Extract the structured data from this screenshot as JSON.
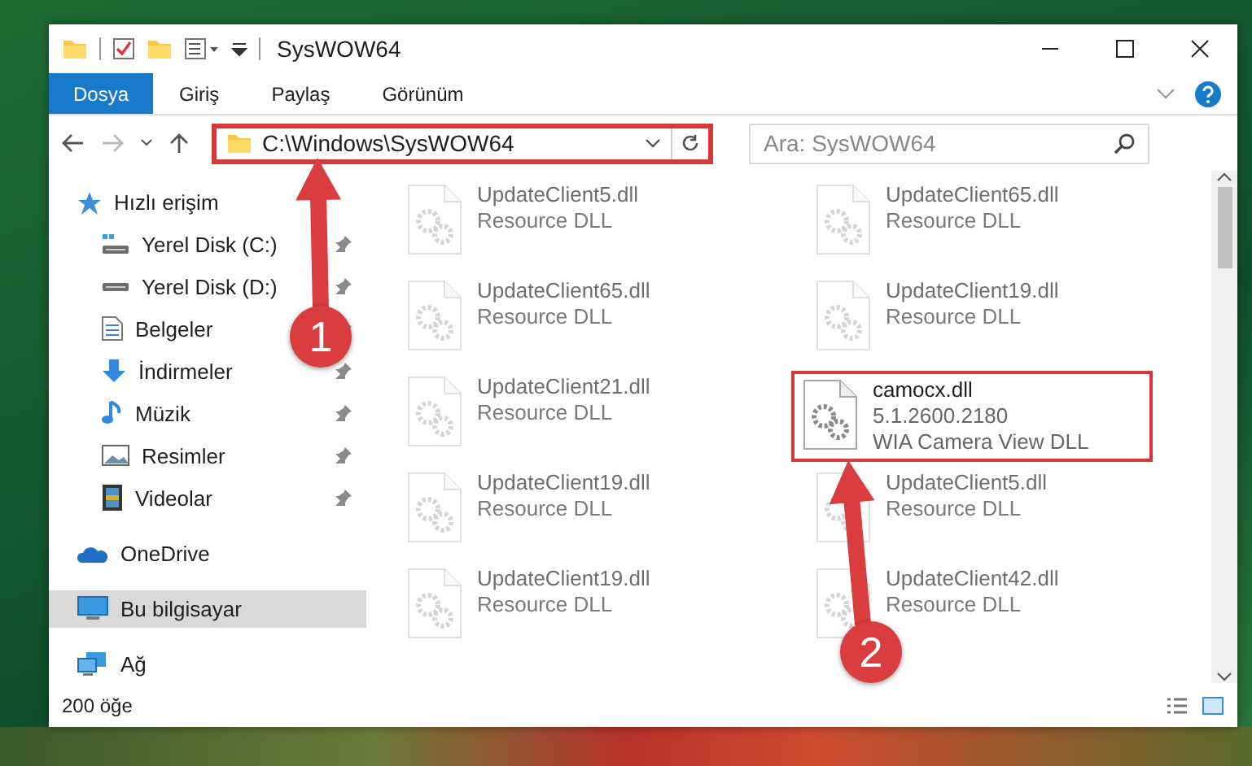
{
  "window": {
    "title": "SysWOW64"
  },
  "ribbon": {
    "tabs": [
      {
        "label": "Dosya",
        "selected": true
      },
      {
        "label": "Giriş",
        "selected": false
      },
      {
        "label": "Paylaş",
        "selected": false
      },
      {
        "label": "Görünüm",
        "selected": false
      }
    ]
  },
  "address_bar": {
    "path": "C:\\Windows\\SysWOW64",
    "highlighted": true
  },
  "search": {
    "placeholder": "Ara: SysWOW64"
  },
  "navigation": [
    {
      "label": "Hızlı erişim",
      "kind": "star",
      "selected": false,
      "children": [
        {
          "label": "Yerel Disk (C:)",
          "kind": "system-drive",
          "pinned": true,
          "selected": false
        },
        {
          "label": "Yerel Disk (D:)",
          "kind": "drive",
          "pinned": true,
          "selected": false
        },
        {
          "label": "Belgeler",
          "kind": "documents",
          "pinned": true,
          "selected": false
        },
        {
          "label": "İndirmeler",
          "kind": "download",
          "pinned": true,
          "selected": false
        },
        {
          "label": "Müzik",
          "kind": "music",
          "pinned": true,
          "selected": false
        },
        {
          "label": "Resimler",
          "kind": "pictures",
          "pinned": true,
          "selected": false
        },
        {
          "label": "Videolar",
          "kind": "videos",
          "pinned": true,
          "selected": false
        }
      ]
    },
    {
      "label": "OneDrive",
      "kind": "cloud",
      "selected": false
    },
    {
      "label": "Bu bilgisayar",
      "kind": "computer",
      "selected": true
    },
    {
      "label": "Ağ",
      "kind": "network",
      "selected": false
    }
  ],
  "files": [
    {
      "name": "UpdateClient5.dll",
      "details": [
        "Resource DLL"
      ],
      "blurred": true,
      "highlighted": false
    },
    {
      "name": "UpdateClient65.dll",
      "details": [
        "Resource DLL"
      ],
      "blurred": true,
      "highlighted": false
    },
    {
      "name": "UpdateClient65.dll",
      "details": [
        "Resource DLL"
      ],
      "blurred": true,
      "highlighted": false
    },
    {
      "name": "UpdateClient19.dll",
      "details": [
        "Resource DLL"
      ],
      "blurred": true,
      "highlighted": false
    },
    {
      "name": "UpdateClient21.dll",
      "details": [
        "Resource DLL"
      ],
      "blurred": true,
      "highlighted": false
    },
    {
      "name": "camocx.dll",
      "details": [
        "5.1.2600.2180",
        "WIA Camera View DLL"
      ],
      "blurred": false,
      "highlighted": true
    },
    {
      "name": "UpdateClient19.dll",
      "details": [
        "Resource DLL"
      ],
      "blurred": true,
      "highlighted": false
    },
    {
      "name": "UpdateClient5.dll",
      "details": [
        "Resource DLL"
      ],
      "blurred": true,
      "highlighted": false
    },
    {
      "name": "UpdateClient19.dll",
      "details": [
        "Resource DLL"
      ],
      "blurred": true,
      "highlighted": false
    },
    {
      "name": "UpdateClient42.dll",
      "details": [
        "Resource DLL"
      ],
      "blurred": true,
      "highlighted": false
    }
  ],
  "status_bar": {
    "item_count": "200 öğe"
  },
  "annotations": [
    {
      "label": "1"
    },
    {
      "label": "2"
    }
  ]
}
